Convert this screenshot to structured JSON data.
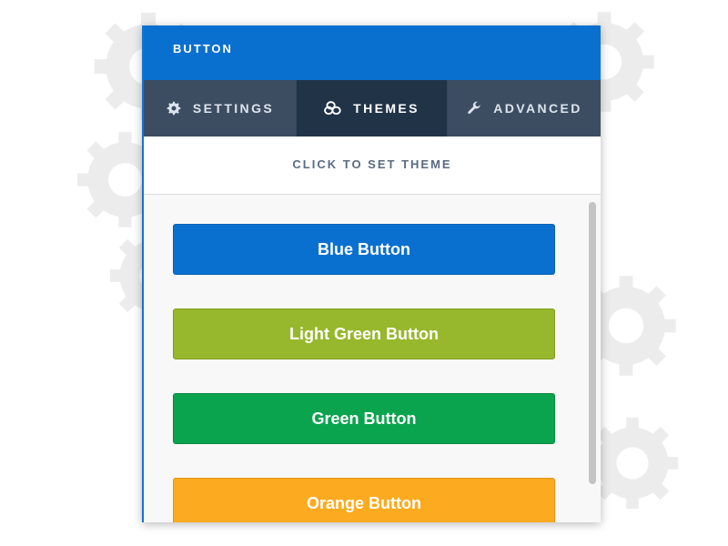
{
  "panel": {
    "title": "BUTTON"
  },
  "tabs": [
    {
      "label": "SETTINGS",
      "icon": "gear-icon",
      "active": false
    },
    {
      "label": "THEMES",
      "icon": "palette-icon",
      "active": true
    },
    {
      "label": "ADVANCED",
      "icon": "wrench-icon",
      "active": false
    }
  ],
  "hint": "CLICK TO SET THEME",
  "themes": [
    {
      "label": "Blue Button",
      "color": "#0a70d0",
      "border": "#0a5fb0"
    },
    {
      "label": "Light Green Button",
      "color": "#97b82c",
      "border": "#809c23"
    },
    {
      "label": "Green Button",
      "color": "#0aa34e",
      "border": "#08893f"
    },
    {
      "label": "Orange Button",
      "color": "#fcaa1f",
      "border": "#e2951a"
    }
  ],
  "colors": {
    "header": "#0a70d0",
    "tabs_bg": "#3c4d62",
    "tab_active": "#213347",
    "background_gears": "#ececec"
  }
}
